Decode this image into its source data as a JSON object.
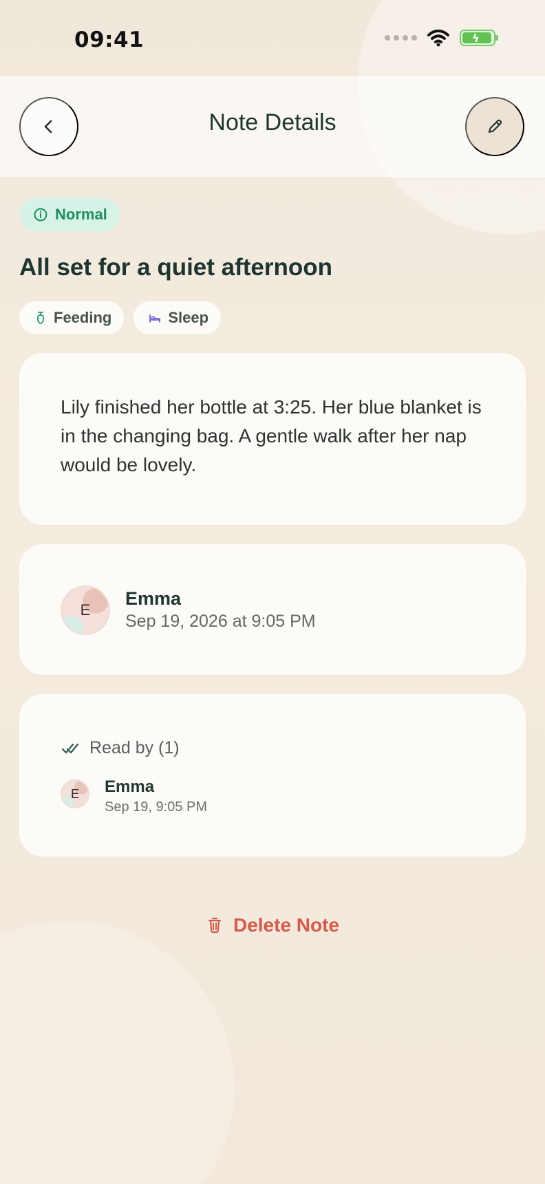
{
  "status_bar": {
    "time": "09:41"
  },
  "header": {
    "title": "Note Details"
  },
  "badge": {
    "label": "Normal",
    "color": "#1d8f62",
    "background": "#d7f3e7"
  },
  "note": {
    "title": "All set for a quiet afternoon",
    "tags": [
      {
        "label": "Feeding",
        "icon": "baby-bottle-icon"
      },
      {
        "label": "Sleep",
        "icon": "bed-icon"
      }
    ],
    "message": "Lily finished her bottle at 3:25. Her blue blanket is in the changing bag. A gentle walk after her nap would be lovely."
  },
  "author": {
    "initial": "E",
    "name": "Emma",
    "timestamp": "Sep 19, 2026 at 9:05 PM"
  },
  "read_by": {
    "label": "Read by (1)",
    "readers": [
      {
        "initial": "E",
        "name": "Emma",
        "timestamp": "Sep 19, 9:05 PM"
      }
    ]
  },
  "actions": {
    "delete_label": "Delete Note",
    "delete_color": "#d65a4a"
  },
  "icons": {
    "back": "chevron-left-icon",
    "edit": "pencil-icon",
    "badge": "info-icon",
    "read": "double-check-icon",
    "delete": "trash-icon",
    "wifi": "wifi-icon",
    "battery": "battery-charging-icon"
  }
}
